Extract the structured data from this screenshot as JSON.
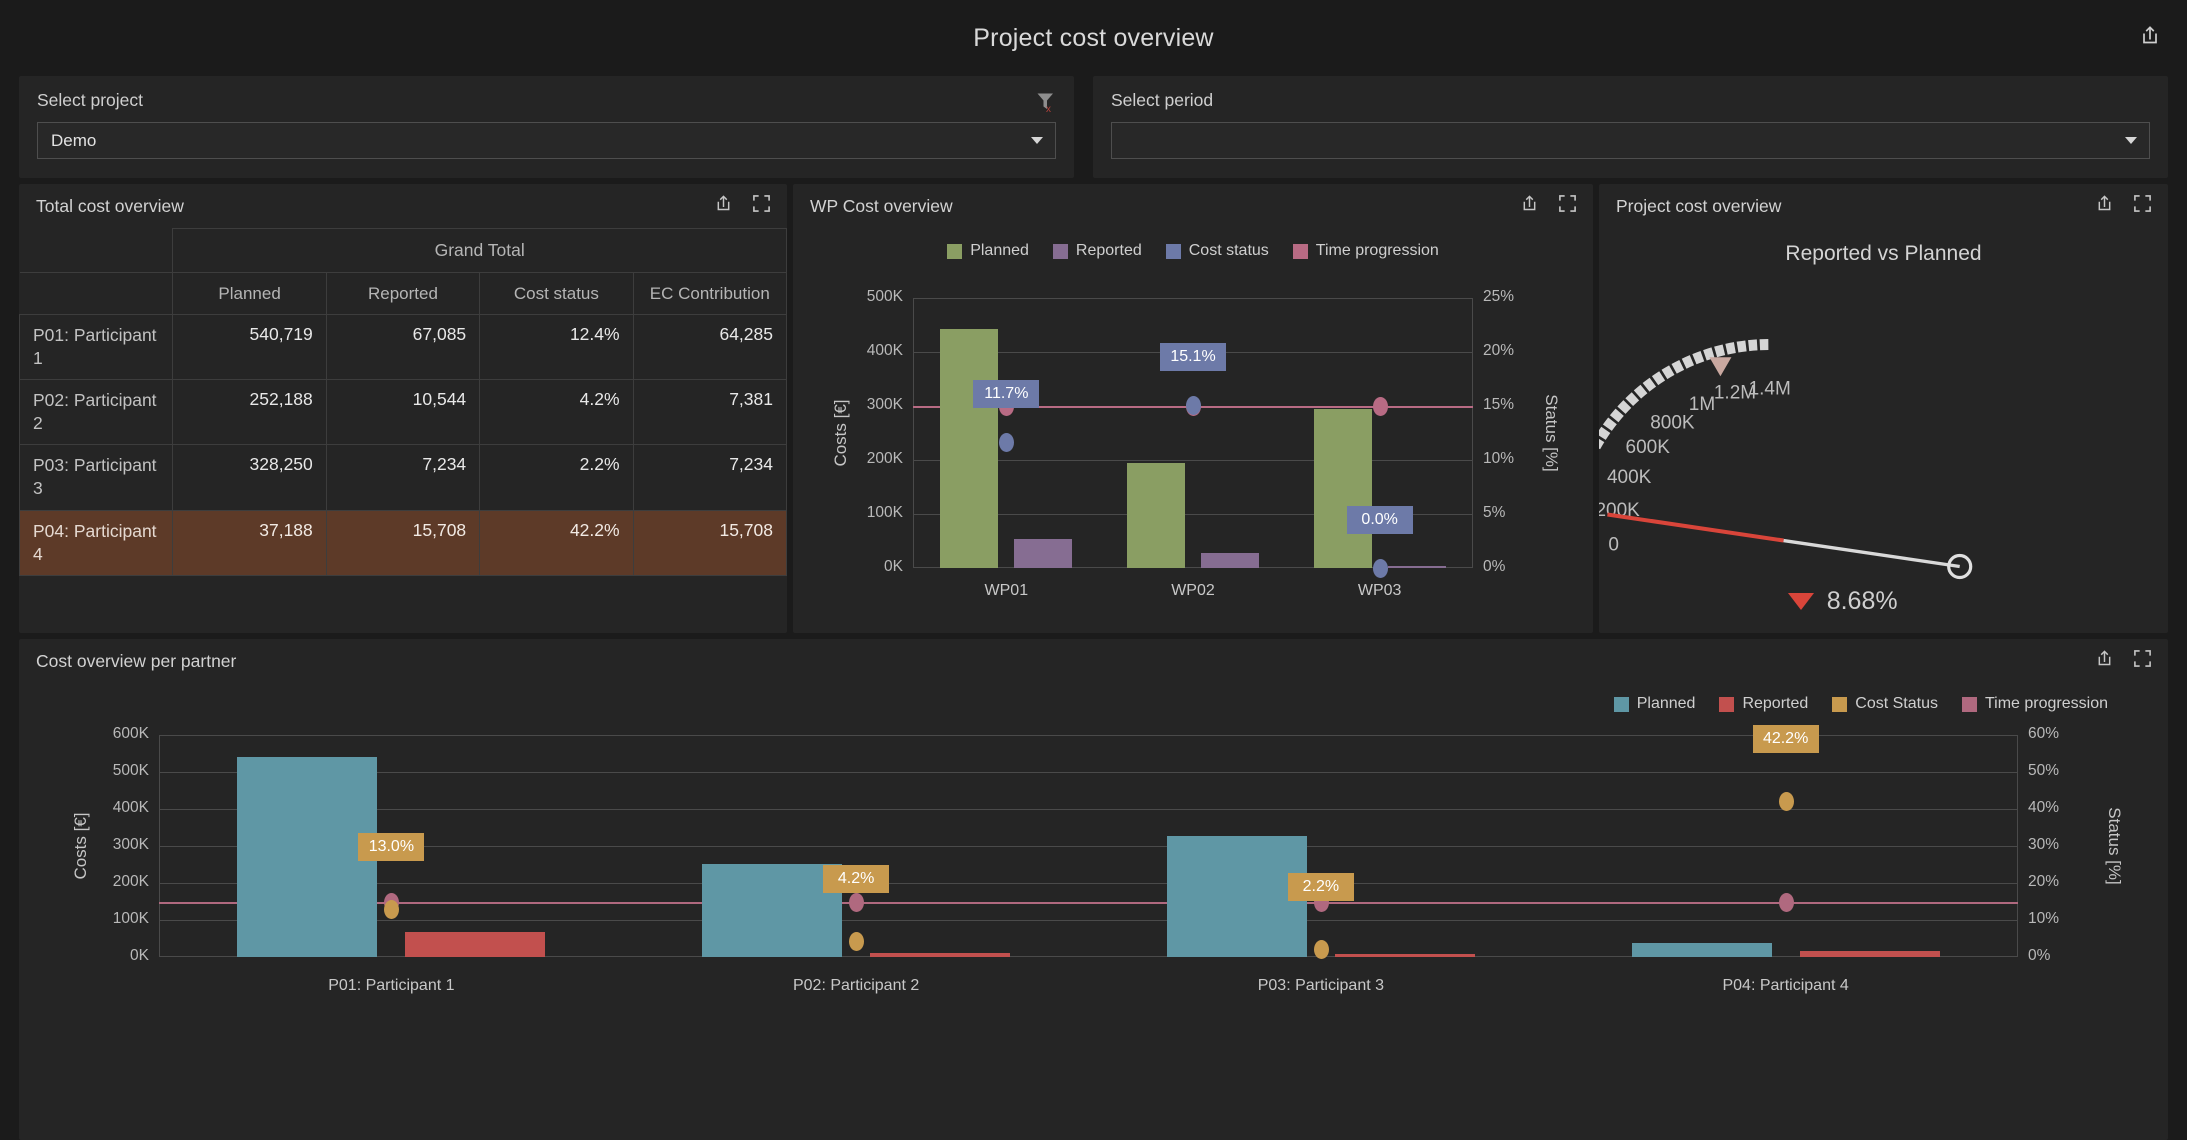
{
  "header": {
    "title": "Project cost overview",
    "export_icon": "export-icon"
  },
  "filters": {
    "project": {
      "label": "Select project",
      "value": "Demo",
      "placeholder": "",
      "clear_icon": "filter-clear-icon",
      "caret_icon": "chevron-down-icon"
    },
    "period": {
      "label": "Select period",
      "value": "",
      "placeholder": "",
      "caret_icon": "chevron-down-icon"
    }
  },
  "panels": {
    "total_cost": {
      "title": "Total cost overview"
    },
    "wp_cost": {
      "title": "WP Cost overview"
    },
    "project_cost": {
      "title": "Project cost overview"
    },
    "partner_cost": {
      "title": "Cost overview per partner"
    }
  },
  "icons": {
    "export": "export-icon",
    "fullscreen": "fullscreen-icon"
  },
  "table": {
    "group_header": "Grand Total",
    "columns": [
      "Planned",
      "Reported",
      "Cost status",
      "EC Contribution"
    ],
    "rows": [
      {
        "name": "P01: Participant 1",
        "planned": "540,719",
        "reported": "67,085",
        "cost_status": "12.4%",
        "ec_contribution": "64,285",
        "highlighted": false
      },
      {
        "name": "P02: Participant 2",
        "planned": "252,188",
        "reported": "10,544",
        "cost_status": "4.2%",
        "ec_contribution": "7,381",
        "highlighted": false
      },
      {
        "name": "P03: Participant 3",
        "planned": "328,250",
        "reported": "7,234",
        "cost_status": "2.2%",
        "ec_contribution": "7,234",
        "highlighted": false
      },
      {
        "name": "P04: Participant 4",
        "planned": "37,188",
        "reported": "15,708",
        "cost_status": "42.2%",
        "ec_contribution": "15,708",
        "highlighted": true
      }
    ]
  },
  "colors": {
    "wp_planned": "#8a9e63",
    "wp_reported": "#866d92",
    "wp_cost_status": "#6d7aa8",
    "wp_time_progression": "#b86b84",
    "partner_planned": "#5f97a5",
    "partner_reported": "#c2504e",
    "partner_cost_status": "#c89a4e",
    "partner_time_progression": "#b0697f",
    "highlight_row": "#5d3a28",
    "gauge_arc": "#d5d5d5",
    "gauge_needle_red": "#d9453a",
    "panel_bg": "#252525",
    "page_bg": "#1b1b1b"
  },
  "chart_data": [
    {
      "id": "wp_cost_overview",
      "type": "bar",
      "title": "WP Cost overview",
      "xlabel": "",
      "ylabel": "Costs [€]",
      "y2label": "Status [%]",
      "categories": [
        "WP01",
        "WP02",
        "WP03"
      ],
      "ylim": [
        0,
        500000
      ],
      "yticks": [
        "0K",
        "100K",
        "200K",
        "300K",
        "400K",
        "500K"
      ],
      "ytick_values": [
        0,
        100000,
        200000,
        300000,
        400000,
        500000
      ],
      "y2lim": [
        0,
        25
      ],
      "y2ticks": [
        "0%",
        "5%",
        "10%",
        "15%",
        "20%",
        "25%"
      ],
      "y2tick_values": [
        0,
        5,
        10,
        15,
        20,
        25
      ],
      "grid": true,
      "legend_position": "top",
      "legend": [
        "Planned",
        "Reported",
        "Cost status",
        "Time progression"
      ],
      "series": [
        {
          "name": "Planned",
          "axis": "left",
          "kind": "bar",
          "values": [
            443000,
            194000,
            295000
          ]
        },
        {
          "name": "Reported",
          "axis": "left",
          "kind": "bar",
          "values": [
            53000,
            28000,
            2000
          ]
        },
        {
          "name": "Cost status",
          "axis": "right",
          "kind": "point",
          "values": [
            11.7,
            15.1,
            0.0
          ],
          "labels": [
            "11.7%",
            "15.1%",
            "0.0%"
          ]
        },
        {
          "name": "Time progression",
          "axis": "right",
          "kind": "line",
          "values": [
            15.0,
            15.0,
            15.0
          ]
        }
      ]
    },
    {
      "id": "project_cost_gauge",
      "type": "gauge",
      "panel_title": "Project cost overview",
      "title": "Reported vs Planned",
      "ticks": [
        "0",
        "200K",
        "400K",
        "600K",
        "800K",
        "1M",
        "1.2M",
        "1.4M"
      ],
      "tick_values": [
        0,
        200000,
        400000,
        600000,
        800000,
        1000000,
        1200000,
        1400000
      ],
      "min": 0,
      "max": 1400000,
      "value": 100625,
      "target": 1158345,
      "target_label": "1.2M",
      "delta_label": "8.68%",
      "delta_direction": "down"
    },
    {
      "id": "cost_overview_per_partner",
      "type": "bar",
      "title": "Cost overview per partner",
      "xlabel": "",
      "ylabel": "Costs [€]",
      "y2label": "Status [%]",
      "categories": [
        "P01: Participant 1",
        "P02: Participant 2",
        "P03: Participant 3",
        "P04: Participant 4"
      ],
      "ylim": [
        0,
        600000
      ],
      "yticks": [
        "0K",
        "100K",
        "200K",
        "300K",
        "400K",
        "500K",
        "600K"
      ],
      "ytick_values": [
        0,
        100000,
        200000,
        300000,
        400000,
        500000,
        600000
      ],
      "y2lim": [
        0,
        60
      ],
      "y2ticks": [
        "0%",
        "10%",
        "20%",
        "30%",
        "40%",
        "50%",
        "60%"
      ],
      "y2tick_values": [
        0,
        10,
        20,
        30,
        40,
        50,
        60
      ],
      "grid": true,
      "legend_position": "top-right",
      "legend": [
        "Planned",
        "Reported",
        "Cost Status",
        "Time progression"
      ],
      "series": [
        {
          "name": "Planned",
          "axis": "left",
          "kind": "bar",
          "values": [
            540719,
            252188,
            328250,
            37188
          ]
        },
        {
          "name": "Reported",
          "axis": "left",
          "kind": "bar",
          "values": [
            67085,
            10544,
            7234,
            15708
          ]
        },
        {
          "name": "Cost Status",
          "axis": "right",
          "kind": "point",
          "values": [
            13.0,
            4.2,
            2.2,
            42.2
          ],
          "labels": [
            "13.0%",
            "4.2%",
            "2.2%",
            "42.2%"
          ]
        },
        {
          "name": "Time progression",
          "axis": "right",
          "kind": "line",
          "values": [
            15.0,
            15.0,
            15.0,
            15.0
          ]
        }
      ]
    }
  ]
}
